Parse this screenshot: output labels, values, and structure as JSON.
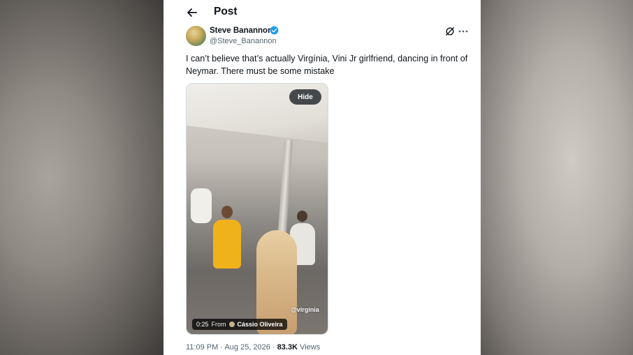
{
  "header": {
    "title": "Post"
  },
  "author": {
    "display_name": "Steve Banannon",
    "handle": "@Steve_Banannon",
    "verified": true
  },
  "tweet": {
    "text": "I can’t believe that’s actually Virgínia, Vini Jr girlfriend, dancing in front of Neymar. There must be some mistake"
  },
  "media": {
    "hide_label": "Hide",
    "watermark": "@virginia",
    "duration": "0:25",
    "from_label": "From",
    "source_name": "Cássio Oliveira"
  },
  "meta": {
    "time": "11:09 PM",
    "separator1": " · ",
    "date": "Aug 25, 2026",
    "separator2": " · ",
    "views_count": "83.3K",
    "views_label": " Views"
  },
  "colors": {
    "text_primary": "#0f1419",
    "text_secondary": "#536471",
    "verified_blue": "#1d9bf0"
  },
  "icons": [
    "back-arrow-icon",
    "verified-badge-icon",
    "grok-icon",
    "more-icon"
  ]
}
